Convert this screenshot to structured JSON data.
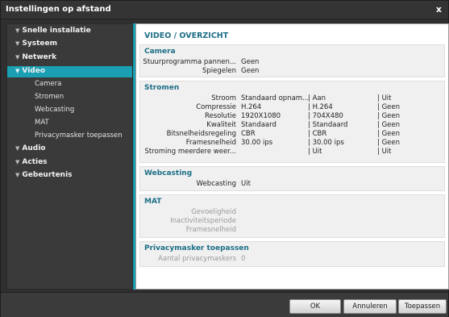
{
  "window": {
    "title": "Instellingen op afstand",
    "close_glyph": "x"
  },
  "sidebar": {
    "items": [
      {
        "label": "Snelle installatie"
      },
      {
        "label": "Systeem"
      },
      {
        "label": "Netwerk"
      },
      {
        "label": "Video"
      },
      {
        "label": "Audio"
      },
      {
        "label": "Acties"
      },
      {
        "label": "Gebeurtenis"
      }
    ],
    "selected": "Video",
    "video_subitems": [
      "Camera",
      "Stromen",
      "Webcasting",
      "MAT",
      "Privacymasker toepassen"
    ]
  },
  "page": {
    "title": "VIDEO / OVERZICHT",
    "camera": {
      "title": "Camera",
      "rows": [
        {
          "label": "Stuurprogramma pannen...",
          "value": "Geen"
        },
        {
          "label": "Spiegelen",
          "value": "Geen"
        }
      ]
    },
    "stromen": {
      "title": "Stromen",
      "rows": [
        {
          "label": "Stroom",
          "c1": "Standaard opnam...",
          "c2": "| Aan",
          "c3": "| Uit"
        },
        {
          "label": "Compressie",
          "c1": "H.264",
          "c2": "| H.264",
          "c3": "| Geen"
        },
        {
          "label": "Resolutie",
          "c1": "1920X1080",
          "c2": "| 704X480",
          "c3": "| Geen"
        },
        {
          "label": "Kwaliteit",
          "c1": "Standaard",
          "c2": "| Standaard",
          "c3": "| Geen"
        },
        {
          "label": "Bitsnelheidsregeling",
          "c1": "CBR",
          "c2": "| CBR",
          "c3": "| Geen"
        },
        {
          "label": "Framesnelheid",
          "c1": "30.00 ips",
          "c2": "| 30.00 ips",
          "c3": "| Geen"
        },
        {
          "label": "Stroming meerdere weer...",
          "c1": "",
          "c2": "| Uit",
          "c3": "| Uit"
        }
      ]
    },
    "webcasting": {
      "title": "Webcasting",
      "rows": [
        {
          "label": "Webcasting",
          "value": "Uit"
        }
      ]
    },
    "mat": {
      "title": "MAT",
      "rows": [
        {
          "label": "Gevoeligheid",
          "value": ""
        },
        {
          "label": "Inactiviteitsperiode",
          "value": ""
        },
        {
          "label": "Framesnelheid",
          "value": ""
        }
      ]
    },
    "privacy": {
      "title": "Privacymasker toepassen",
      "rows": [
        {
          "label": "Aantal privacymaskers",
          "value": "0"
        }
      ]
    }
  },
  "footer": {
    "ok": "OK",
    "cancel": "Annuleren",
    "apply": "Toepassen"
  },
  "colors": {
    "accent": "#1b9fb3",
    "section_title": "#1c6e86"
  }
}
